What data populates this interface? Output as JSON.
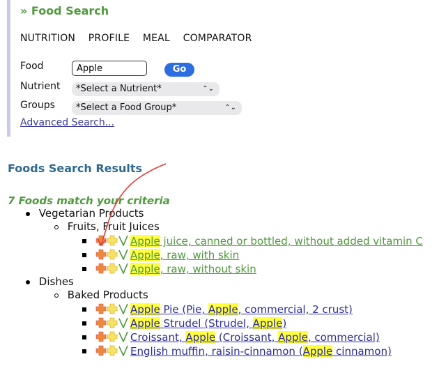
{
  "header": {
    "title": "» Food Search"
  },
  "tabs": [
    "NUTRITION",
    "PROFILE",
    "MEAL",
    "COMPARATOR"
  ],
  "form": {
    "food_label": "Food",
    "food_value": "Apple",
    "go_label": "Go",
    "nutrient_label": "Nutrient",
    "nutrient_value": "*Select a Nutrient*",
    "groups_label": "Groups",
    "groups_value": "*Select a Food Group*",
    "advanced_label": "Advanced Search..."
  },
  "results": {
    "title": "Foods Search Results",
    "count": "7 Foods match your criteria",
    "categories": [
      {
        "name": "Vegetarian Products",
        "subcategory": "Fruits, Fruit Juices"
      },
      {
        "name": "Dishes",
        "subcategory": "Baked Products"
      }
    ],
    "items": [
      {
        "parts": [
          "Apple",
          " juice, canned or bottled, without added vitamin C"
        ]
      },
      {
        "parts": [
          "Apple",
          ", raw, with skin"
        ]
      },
      {
        "parts": [
          "Apple",
          ", raw, without skin"
        ]
      },
      {
        "parts": [
          "Apple",
          " Pie (Pie, ",
          "Apple",
          ", commercial, 2 crust)"
        ]
      },
      {
        "parts": [
          "Apple",
          " Strudel (Strudel, ",
          "Apple",
          ")"
        ]
      },
      {
        "parts": [
          "Croissant, ",
          "Apple",
          " (Croissant, ",
          "Apple",
          ", commercial)"
        ]
      },
      {
        "parts": [
          "English muffin, raisin-cinnamon (",
          "Apple",
          " cinnamon)"
        ]
      }
    ]
  },
  "colors": {
    "accent_green": "#4f9a3c",
    "link_blue": "#2c2c9a",
    "highlight": "#ffff40",
    "annotation_red": "#e0403a"
  },
  "icons": [
    "add-orange-icon",
    "add-yellow-icon",
    "vegetarian-check-icon"
  ]
}
